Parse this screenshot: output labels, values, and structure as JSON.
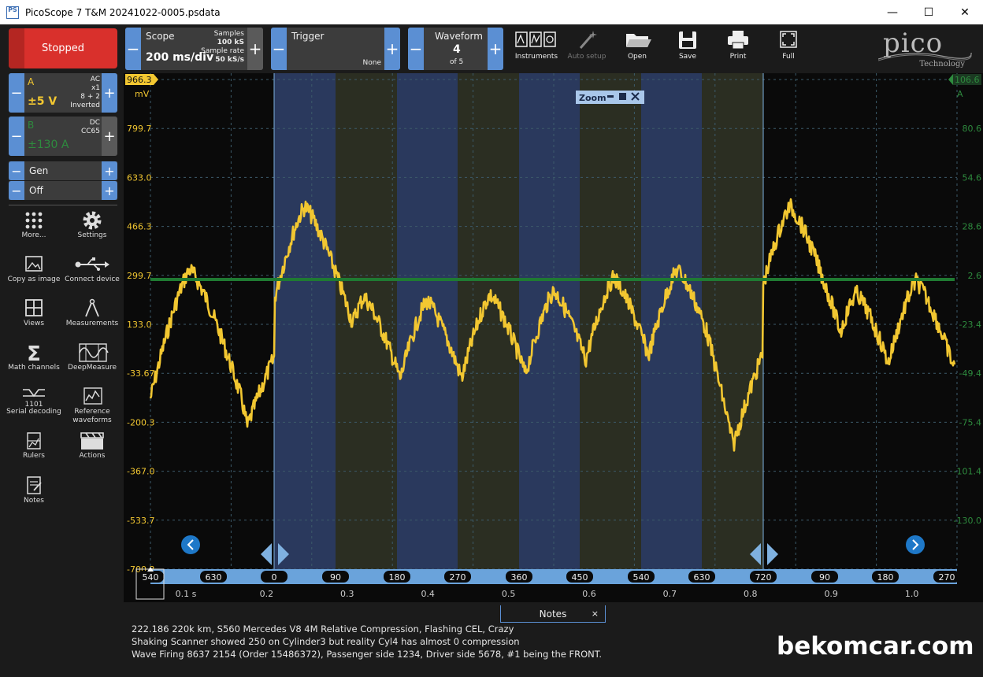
{
  "window": {
    "title": "PicoScope 7 T&M 20241022-0005.psdata",
    "app_icon": "PS",
    "minimize": "—",
    "maximize": "☐",
    "close": "✕"
  },
  "sidebar": {
    "stop_label": "Stopped",
    "channel_a": {
      "letter": "A",
      "range": "±5 V",
      "coupling": "AC",
      "probe": "x1",
      "math": "8 + 2",
      "mode": "Inverted",
      "color": "#f2c731"
    },
    "channel_b": {
      "letter": "B",
      "range": "±130 A",
      "coupling": "DC",
      "probe": "CC65",
      "color": "#2e8b3e"
    },
    "gen": {
      "label": "Gen",
      "state": "Off"
    },
    "tools": [
      {
        "name": "more",
        "label": "More..."
      },
      {
        "name": "settings",
        "label": "Settings"
      },
      {
        "name": "copy-as-image",
        "label": "Copy as image"
      },
      {
        "name": "connect-device",
        "label": "Connect device"
      },
      {
        "name": "views",
        "label": "Views"
      },
      {
        "name": "measurements",
        "label": "Measurements"
      },
      {
        "name": "math-channels",
        "label": "Math channels"
      },
      {
        "name": "deepmeasure",
        "label": "DeepMeasure"
      },
      {
        "name": "serial-decoding",
        "label": "Serial decoding"
      },
      {
        "name": "reference-waveforms",
        "label1": "Reference",
        "label2": "waveforms"
      },
      {
        "name": "rulers",
        "label": "Rulers"
      },
      {
        "name": "actions",
        "label": "Actions"
      },
      {
        "name": "notes",
        "label": "Notes"
      }
    ]
  },
  "toolbar": {
    "scope": {
      "label": "Scope",
      "timebase": "200 ms/div",
      "samples_label": "Samples",
      "samples": "100 kS",
      "rate_label": "Sample rate",
      "rate": "50 kS/s"
    },
    "trigger": {
      "label": "Trigger",
      "mode": "None"
    },
    "waveform": {
      "label": "Waveform",
      "current": "4",
      "total": "of 5"
    },
    "buttons": {
      "instruments": "Instruments",
      "auto_setup": "Auto setup",
      "open": "Open",
      "save": "Save",
      "print": "Print",
      "full": "Full"
    },
    "logo": {
      "brand": "pico",
      "sub": "Technology"
    }
  },
  "scope": {
    "left_axis": {
      "unit": "mV",
      "top": "966.3",
      "ticks": [
        "799.7",
        "633.0",
        "466.3",
        "299.7",
        "133.0",
        "-33.67",
        "-200.3",
        "-367.0",
        "-533.7",
        "-700.3"
      ]
    },
    "right_axis": {
      "unit": "A",
      "top": "106.6",
      "ticks": [
        "80.6",
        "54.6",
        "28.6",
        "2.6",
        "-23.4",
        "-49.4",
        "-75.4",
        "-101.4",
        "-130.0"
      ]
    },
    "time_axis": {
      "labels": [
        "0.1 s",
        "0.2",
        "0.3",
        "0.4",
        "0.5",
        "0.6",
        "0.7",
        "0.8",
        "0.9",
        "1.0"
      ]
    },
    "crank_angles": [
      "540",
      "630",
      "0",
      "90",
      "180",
      "270",
      "360",
      "450",
      "540",
      "630",
      "720",
      "90",
      "180",
      "270"
    ],
    "zoom": {
      "label": "Zoom"
    },
    "colors": {
      "trace_a": "#f2c731",
      "trace_b": "#1f7a32",
      "band_blue": "#2e3f6a",
      "band_olive": "#2f3324",
      "ruler": "#7fb1e0"
    }
  },
  "notes": {
    "tab": "Notes",
    "close": "×",
    "lines": [
      "222.186 220k km, S560 Mercedes V8 4M Relative Compression, Flashing CEL, Crazy",
      "Shaking Scanner showed 250 on Cylinder3 but reality Cyl4 has almost 0 compression",
      "Wave Firing 8637 2154 (Order 15486372), Passenger side 1234, Driver side 5678, #1 being the  FRONT."
    ]
  },
  "watermark": "bekomcar.com"
}
